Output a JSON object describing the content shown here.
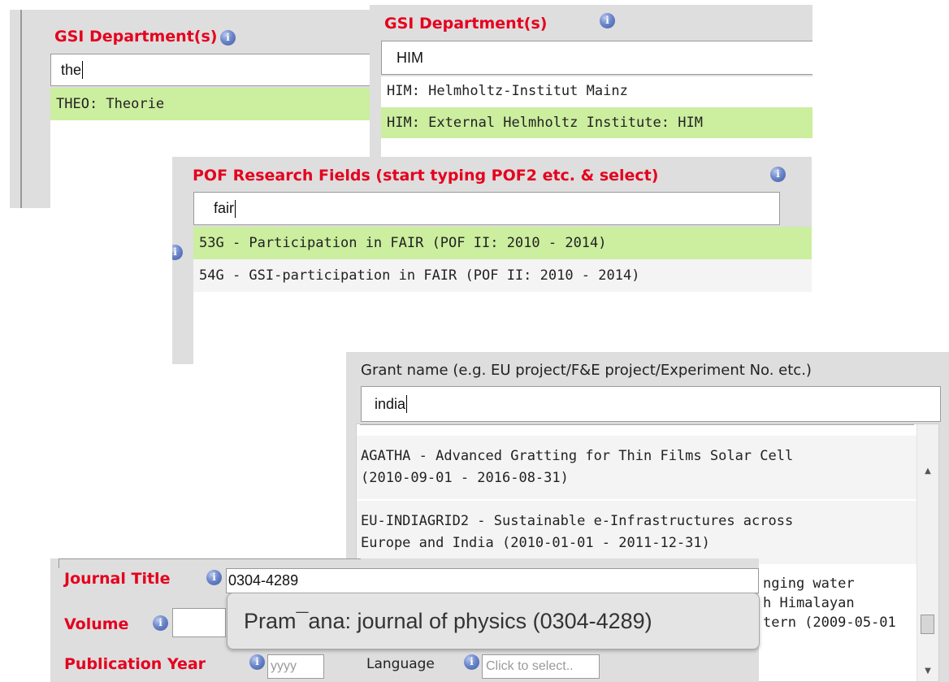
{
  "gsi_dept_1": {
    "label": "GSI Department(s)",
    "info_icon": "i",
    "input_value": "the",
    "options": [
      {
        "text": "THEO: Theorie",
        "highlighted": true
      }
    ]
  },
  "gsi_dept_2": {
    "label": "GSI Department(s)",
    "info_icon": "i",
    "input_value": "HIM",
    "options": [
      {
        "text": "HIM: Helmholtz-Institut Mainz",
        "highlighted": false
      },
      {
        "text": "HIM: External Helmholtz Institute: HIM",
        "highlighted": true
      }
    ]
  },
  "pof": {
    "label": "POF Research Fields (start typing POF2 etc. & select)",
    "info_icon": "i",
    "input_value": "fair",
    "options": [
      {
        "text": "53G - Participation in FAIR (POF II: 2010 - 2014)",
        "highlighted": true
      },
      {
        "text": "54G - GSI-participation in FAIR (POF II: 2010 - 2014)",
        "highlighted": false
      }
    ]
  },
  "grant": {
    "label": "Grant name (e.g. EU project/F&E project/Experiment No. etc.)",
    "input_value": "india",
    "options": [
      {
        "line1": "AGATHA - Advanced Gratting for Thin Films Solar Cell",
        "line2": "(2010-09-01 - 2016-08-31)"
      },
      {
        "line1": "EU-INDIAGRID2 - Sustainable e-Infrastructures across",
        "line2": "Europe and India (2010-01-01 - 2011-12-31)"
      }
    ],
    "partial_option_lines": [
      "nging water",
      "h Himalayan",
      "tern (2009-05-01"
    ],
    "scroll_up_icon": "▲",
    "scroll_down_icon": "▼"
  },
  "bibliographic": {
    "journal_label": "Journal Title",
    "journal_value": "0304-4289",
    "journal_suggestion": "Pram¯ana: journal of physics (0304-4289)",
    "volume_label": "Volume",
    "pubyear_label": "Publication Year",
    "pubyear_placeholder": "yyyy",
    "language_label": "Language",
    "language_placeholder": "Click to select..",
    "info_icon": "i"
  },
  "colors": {
    "required_label": "#e5001e",
    "highlight": "#ccee9f",
    "panel_bg": "#dedede",
    "info_icon": "#4f6bb8"
  }
}
